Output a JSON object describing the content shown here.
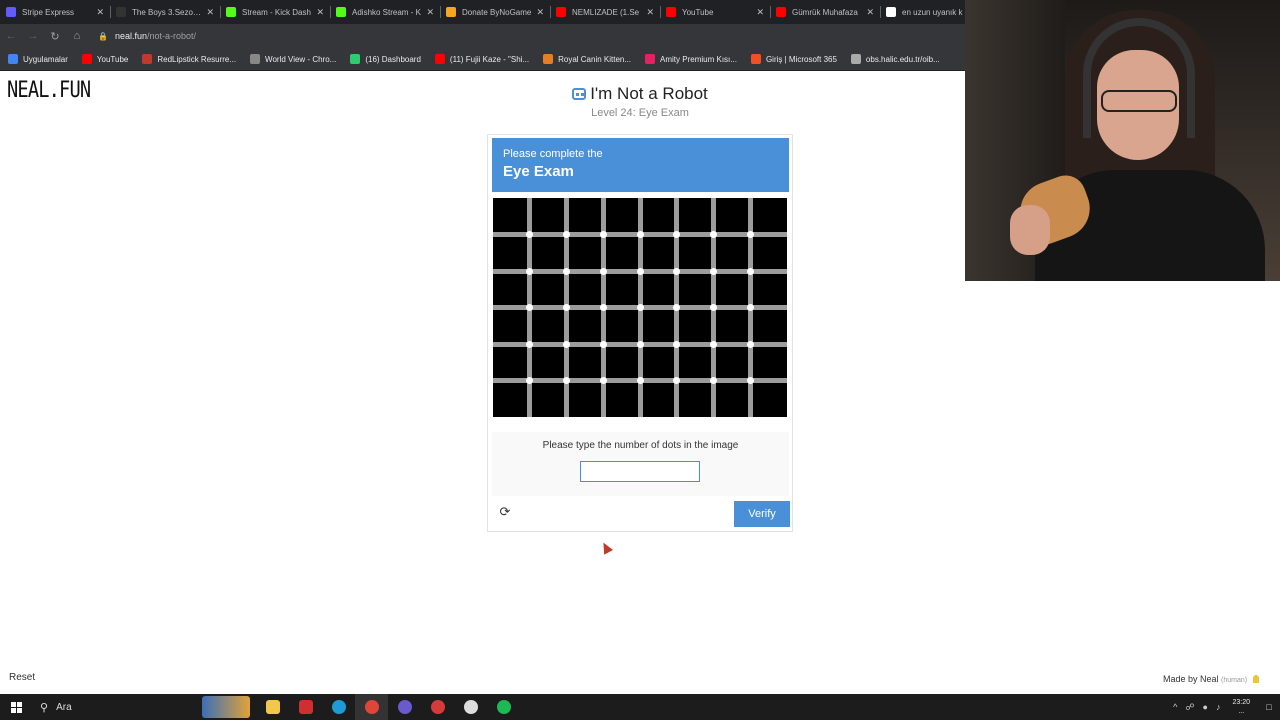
{
  "browser": {
    "tabs": [
      {
        "title": "Stripe Express",
        "color": "#635bff"
      },
      {
        "title": "The Boys 3.Sezon 1",
        "color": "#333333"
      },
      {
        "title": "Stream - Kick Dash",
        "color": "#53fc18"
      },
      {
        "title": "Adishko Stream - K",
        "color": "#53fc18"
      },
      {
        "title": "Donate ByNoGame",
        "color": "#f5a623"
      },
      {
        "title": "NEMLIZADE (1.Se",
        "color": "#ff0000"
      },
      {
        "title": "YouTube",
        "color": "#ff0000"
      },
      {
        "title": "Gümrük Muhafaza",
        "color": "#ff0000"
      },
      {
        "title": "en uzun uyanık k",
        "color": "#ffffff"
      }
    ],
    "url_host": "neal.fun",
    "url_path": "/not-a-robot/",
    "bookmarks": [
      {
        "label": "Uygulamalar",
        "color": "#4285f4"
      },
      {
        "label": "YouTube",
        "color": "#ff0000"
      },
      {
        "label": "RedLipstick Resurre...",
        "color": "#c0392b"
      },
      {
        "label": "World View - Chro...",
        "color": "#888888"
      },
      {
        "label": "(16) Dashboard",
        "color": "#2ecc71"
      },
      {
        "label": "(11) Fujii Kaze - \"Shi...",
        "color": "#ff0000"
      },
      {
        "label": "Royal Canin Kitten...",
        "color": "#e67e22"
      },
      {
        "label": "Amity Premium Kısı...",
        "color": "#e91e63"
      },
      {
        "label": "Giriş | Microsoft 365",
        "color": "#f25022"
      },
      {
        "label": "obs.halic.edu.tr/oib...",
        "color": "#aaaaaa"
      }
    ]
  },
  "page": {
    "logo": "NEAL.FUN",
    "title": "I'm Not a Robot",
    "subtitle": "Level 24: Eye Exam",
    "card_heading_small": "Please complete the",
    "card_heading_large": "Eye Exam",
    "prompt": "Please type the number of dots in the image",
    "answer_value": "",
    "verify_label": "Verify",
    "reset_label": "Reset",
    "made_by": "Made by Neal",
    "made_by_note": "(human)",
    "accent_color": "#4a90d9"
  },
  "taskbar": {
    "search_label": "Ara",
    "apps": [
      {
        "name": "file-explorer",
        "color": "#f2c84b"
      },
      {
        "name": "opera",
        "color": "#d12f2f"
      },
      {
        "name": "edge",
        "color": "#1e9ad6"
      },
      {
        "name": "chrome",
        "color": "#e0453a"
      },
      {
        "name": "discord-like",
        "color": "#6a5acd"
      },
      {
        "name": "obs-like",
        "color": "#d63b3b"
      },
      {
        "name": "app-dark",
        "color": "#dddddd"
      },
      {
        "name": "spotify",
        "color": "#1db954"
      }
    ],
    "time": "23:20",
    "date": "..."
  }
}
